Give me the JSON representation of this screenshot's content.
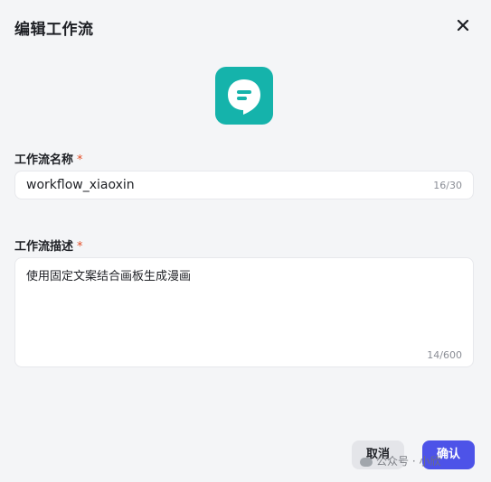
{
  "dialog": {
    "title": "编辑工作流",
    "close_icon": "close-icon"
  },
  "app_icon": {
    "name": "chat-bubble-icon",
    "background": "#15b3ab"
  },
  "name_field": {
    "label": "工作流名称",
    "required_mark": "*",
    "value": "workflow_xiaoxin",
    "counter": "16/30"
  },
  "description_field": {
    "label": "工作流描述",
    "required_mark": "*",
    "value": "使用固定文案结合画板生成漫画",
    "counter": "14/600"
  },
  "buttons": {
    "cancel": "取消",
    "confirm": "确认"
  },
  "watermark": {
    "text": "公众号 · 小欣"
  },
  "colors": {
    "accent": "#4d53e8",
    "required": "#e34d26"
  }
}
